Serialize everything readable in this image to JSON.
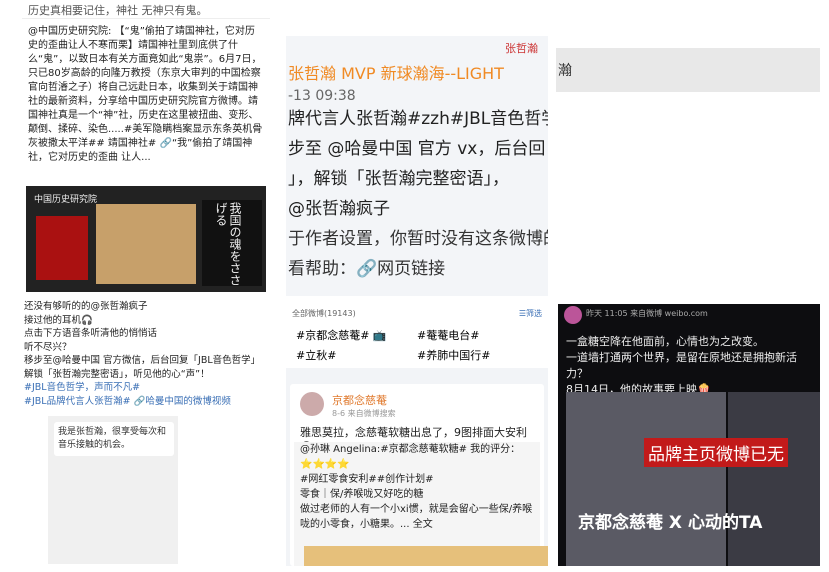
{
  "panel1": {
    "top_line": "历史真相要记住，神社 无神只有鬼。",
    "body": "@中国历史研究院: 【“鬼”偷拍了靖国神社，它对历史的歪曲让人不寒而栗】靖国神社里到底供了什么“鬼”，以致日本有关方面竟如此“鬼祟”。6月7日，只已80岁高龄的向隆万教授（东京大审判的中国检察官向哲濬之子）将自己远赴日本，收集到关于靖国神社的最新资料，分享给中国历史研究院官方微博。靖国神社真是一个“神”社，历史在这里被扭曲、变形、颠倒、揉碎、染色.....#美军隐瞒档案显示东条英机骨灰被撒太平洋## 靖国神社# 🔗“我”偷拍了靖国神社，它对历史的歪曲 让人...",
    "img_caption": "中国历史研究院",
    "img_vertical": "我国の魂をささげる"
  },
  "panel2": {
    "title": "张哲瀚 MVP 新球瀚海--LIGHT",
    "time": "-13 09:38",
    "line1": "牌代言人张哲瀚#zzh#JBL音色哲学",
    "line2": "步至 @哈曼中国 官方 vx，后台回",
    "line3": "」，解锁「张哲瀚完整密语」，",
    "line4": "@张哲瀚疯子",
    "line5": "于作者设置，你暂时没有这条微博的",
    "line6": "看帮助：🔗网页链接",
    "tag": "张哲瀚"
  },
  "panel3": {
    "text": "瀚"
  },
  "panel4": {
    "lines": [
      "还没有够听的的@张哲瀚疯子",
      "接过他的耳机🎧",
      "点击下方语音条听清他的悄悄话",
      "听不尽兴？",
      "移步至@哈曼中国 官方微信，后台回复「JBL音色哲学」",
      "解锁「张哲瀚完整密语」，听见他的心“声”！",
      "#JBL音色哲学，声而不凡#",
      "#JBL品牌代言人张哲瀚# 🔗哈曼中国的微博视频"
    ],
    "chat": "我是张哲瀚，很享受每次和音乐接触的机会。"
  },
  "panel5": {
    "bar_left": "全部微博(19143)",
    "bar_right": "☰筛选",
    "tags": [
      "#京都念慈菴# 📺",
      "#菴菴电台#",
      "#立秋#",
      "#养肺中国行#"
    ],
    "name": "京都念慈菴",
    "meta": "8-6  来自微博搜索",
    "text": "雅思莫拉，念慈菴软糖出息了，9图排面大安利 😂",
    "repost": [
      "@孙琳 Angelina:#京都念慈菴软糖# 我的评分：⭐⭐⭐⭐",
      "#网红零食安利##创作计划#",
      "零食｜保/养喉咙又好吃的糖",
      "",
      "做过老师的人有一个小xi惯，就是会留心一些保/养喉咙的小零食，小糖果。... 全文"
    ]
  },
  "panel6": {
    "head": "昨天 11:05  来自微博 weibo.com",
    "t1": "一盒糖空降在他面前，心情也为之改变。",
    "t2": "一道墙打通两个世界，是留在原地还是拥抱新活力？",
    "t3": "8月14日，他的故事要上映🍿",
    "brand_note": "品牌主页微博已无",
    "film_title": "京都念慈菴 X 心动的TA"
  }
}
